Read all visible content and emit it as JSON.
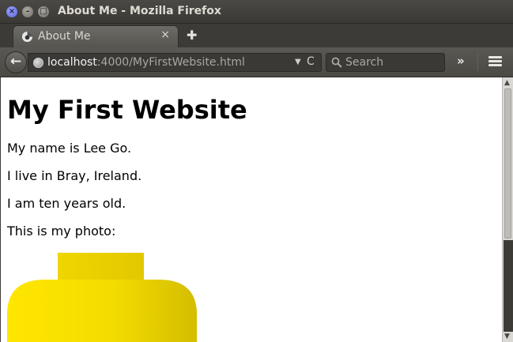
{
  "window": {
    "title": "About Me - Mozilla Firefox",
    "close_glyph": "×",
    "min_glyph": "–",
    "max_glyph": "□"
  },
  "tab": {
    "label": "About Me",
    "close_glyph": "×",
    "new_tab_glyph": "✚"
  },
  "navbar": {
    "back_glyph": "←",
    "url_host": "localhost",
    "url_path": ":4000/MyFirstWebsite.html",
    "dropdown_glyph": "▼",
    "reload_glyph": "C",
    "search_placeholder": "Search",
    "overflow_glyph": "»"
  },
  "page": {
    "heading": "My First Website",
    "paragraphs": [
      "My name is Lee Go.",
      "I live in Bray, Ireland.",
      "I am ten years old.",
      "This is my photo:"
    ],
    "photo_colors": {
      "light": "#ffe600",
      "dark": "#d8c000"
    }
  },
  "scrollbar": {
    "up_glyph": "▲",
    "down_glyph": "▼"
  },
  "icons": [
    "close-icon",
    "minimize-icon",
    "maximize-icon",
    "firefox-tab-icon",
    "plus-icon",
    "back-arrow-icon",
    "globe-icon",
    "dropdown-arrow-icon",
    "reload-icon",
    "search-icon",
    "overflow-chevron-icon",
    "hamburger-menu-icon"
  ]
}
